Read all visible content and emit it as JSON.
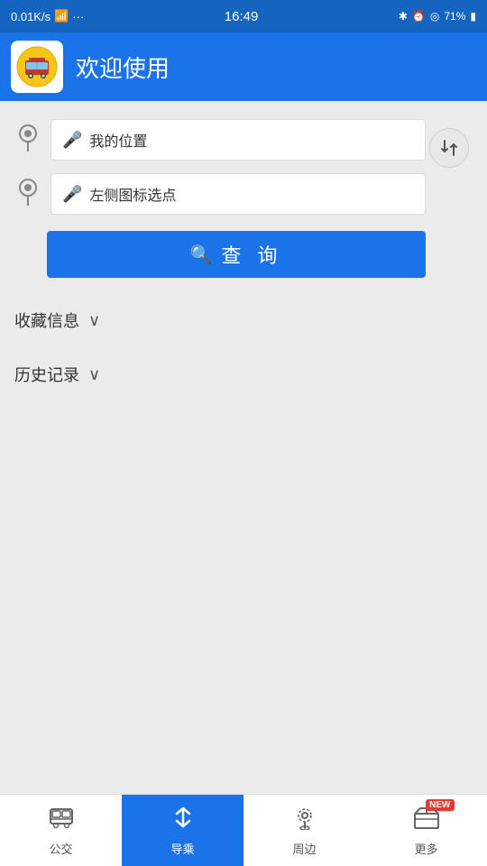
{
  "status_bar": {
    "signal": "0.01K/s",
    "wifi": "wifi",
    "time": "16:49",
    "battery": "71%"
  },
  "header": {
    "title": "欢迎使用"
  },
  "search": {
    "input1": {
      "placeholder": "我的位置",
      "value": "我的位置"
    },
    "input2": {
      "placeholder": "左侧图标选点",
      "value": "左侧图标选点"
    },
    "query_button": "查  询"
  },
  "sections": {
    "favorites": "收藏信息",
    "history": "历史记录"
  },
  "bottom_nav": {
    "items": [
      {
        "id": "bus",
        "label": "公交",
        "active": false
      },
      {
        "id": "guide",
        "label": "导乘",
        "active": true
      },
      {
        "id": "nearby",
        "label": "周边",
        "active": false
      },
      {
        "id": "more",
        "label": "更多",
        "active": false,
        "badge": "NEW"
      }
    ]
  }
}
